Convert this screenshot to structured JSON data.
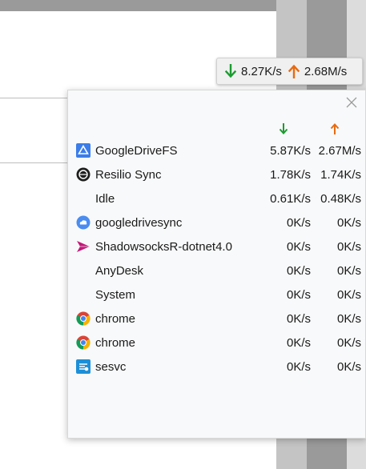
{
  "speed_widget": {
    "download": "8.27K/s",
    "upload": "2.68M/s",
    "download_icon": "arrow-down-icon",
    "upload_icon": "arrow-up-icon",
    "download_color": "#1a9c2e",
    "upload_color": "#e86a10"
  },
  "panel": {
    "close_icon": "close-icon",
    "rows": [
      {
        "name": "GoogleDriveFS",
        "download": "5.87K/s",
        "upload": "2.67M/s",
        "icon": "google-drive-fs-icon"
      },
      {
        "name": "Resilio Sync",
        "download": "1.78K/s",
        "upload": "1.74K/s",
        "icon": "resilio-sync-icon"
      },
      {
        "name": "Idle",
        "download": "0.61K/s",
        "upload": "0.48K/s",
        "icon": ""
      },
      {
        "name": "googledrivesync",
        "download": "0K/s",
        "upload": "0K/s",
        "icon": "google-backup-sync-icon"
      },
      {
        "name": "ShadowsocksR-dotnet4.0",
        "download": "0K/s",
        "upload": "0K/s",
        "icon": "shadowsocksr-icon"
      },
      {
        "name": "AnyDesk",
        "download": "0K/s",
        "upload": "0K/s",
        "icon": ""
      },
      {
        "name": "System",
        "download": "0K/s",
        "upload": "0K/s",
        "icon": ""
      },
      {
        "name": "chrome",
        "download": "0K/s",
        "upload": "0K/s",
        "icon": "chrome-icon"
      },
      {
        "name": "chrome",
        "download": "0K/s",
        "upload": "0K/s",
        "icon": "chrome-icon"
      },
      {
        "name": "sesvc",
        "download": "0K/s",
        "upload": "0K/s",
        "icon": "sesvc-icon"
      }
    ]
  }
}
